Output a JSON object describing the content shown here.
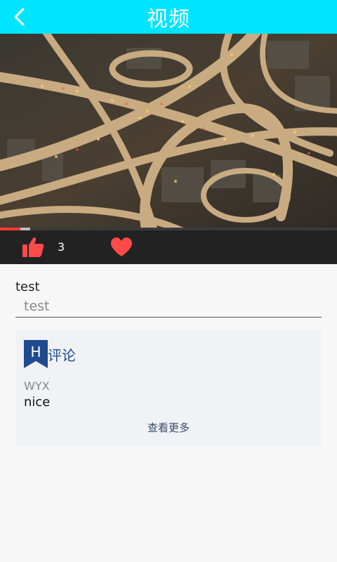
{
  "header": {
    "title": "视频",
    "back_icon": "chevron-left-icon",
    "background": "#00e5ff"
  },
  "video": {
    "progress_fraction": 0.06,
    "buffered_fraction": 0.09
  },
  "actions": {
    "like_icon": "thumbs-up-icon",
    "like_count": "3",
    "favorite_icon": "heart-icon",
    "accent": "#ff4a4a"
  },
  "form": {
    "label": "test",
    "input_value": "test"
  },
  "comments": {
    "badge_letter": "H",
    "title": "评论",
    "items": [
      {
        "author": "WYX",
        "text": "nice"
      }
    ],
    "more_label": "查看更多"
  }
}
